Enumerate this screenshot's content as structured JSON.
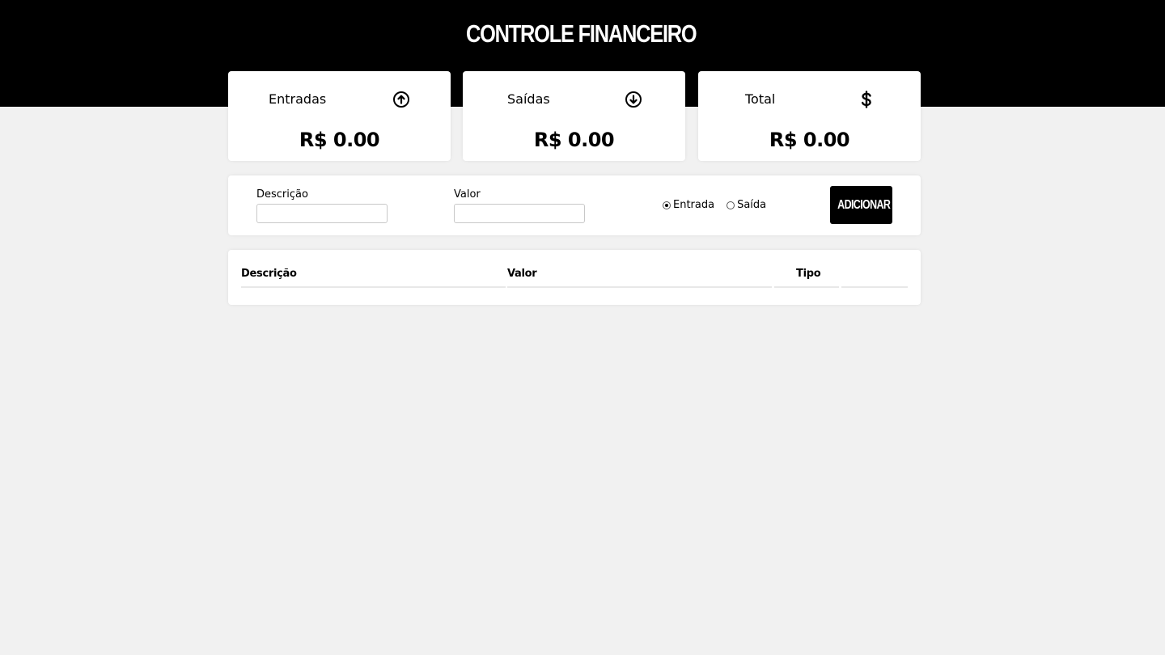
{
  "header": {
    "title": "CONTROLE FINANCEIRO"
  },
  "cards": {
    "income": {
      "label": "Entradas",
      "value": "R$ 0.00",
      "icon": "arrow-up-circle-icon"
    },
    "expense": {
      "label": "Saídas",
      "value": "R$ 0.00",
      "icon": "arrow-down-circle-icon"
    },
    "total": {
      "label": "Total",
      "value": "R$ 0.00",
      "icon": "dollar-icon"
    }
  },
  "form": {
    "description_label": "Descrição",
    "description_value": "",
    "amount_label": "Valor",
    "amount_value": "",
    "type_options": [
      {
        "label": "Entrada",
        "checked": true
      },
      {
        "label": "Saída",
        "checked": false
      }
    ],
    "add_button_label": "ADICIONAR"
  },
  "table": {
    "columns": [
      "Descrição",
      "Valor",
      "Tipo",
      ""
    ],
    "rows": []
  },
  "colors": {
    "header_bg": "#000000",
    "page_bg": "#f1f1f1",
    "card_bg": "#ffffff",
    "button_bg": "#000000"
  }
}
